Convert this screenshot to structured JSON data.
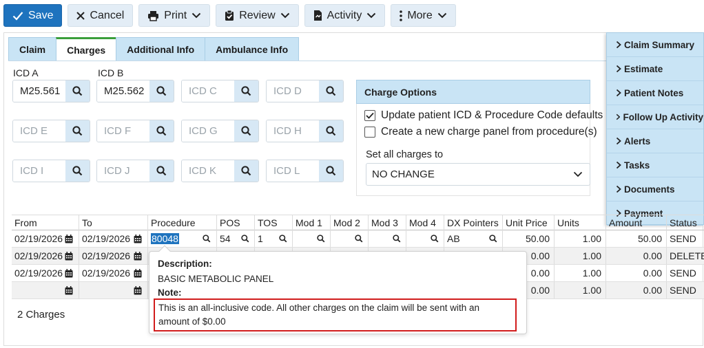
{
  "toolbar": {
    "save": "Save",
    "cancel": "Cancel",
    "print": "Print",
    "review": "Review",
    "activity": "Activity",
    "more": "More"
  },
  "tabs": [
    "Claim",
    "Charges",
    "Additional Info",
    "Ambulance Info"
  ],
  "icd": {
    "label_a": "ICD A",
    "label_b": "ICD B",
    "fields": [
      {
        "placeholder": "ICD A",
        "value": "M25.561"
      },
      {
        "placeholder": "ICD B",
        "value": "M25.562"
      },
      {
        "placeholder": "ICD C",
        "value": ""
      },
      {
        "placeholder": "ICD D",
        "value": ""
      },
      {
        "placeholder": "ICD E",
        "value": ""
      },
      {
        "placeholder": "ICD F",
        "value": ""
      },
      {
        "placeholder": "ICD G",
        "value": ""
      },
      {
        "placeholder": "ICD H",
        "value": ""
      },
      {
        "placeholder": "ICD I",
        "value": ""
      },
      {
        "placeholder": "ICD J",
        "value": ""
      },
      {
        "placeholder": "ICD K",
        "value": ""
      },
      {
        "placeholder": "ICD L",
        "value": ""
      }
    ]
  },
  "charge_options": {
    "title": "Charge Options",
    "update_defaults": "Update patient ICD & Procedure Code defaults",
    "update_checked": true,
    "new_panel": "Create a new charge panel from procedure(s)",
    "new_panel_checked": false,
    "set_all_label": "Set all charges to",
    "set_all_value": "NO CHANGE"
  },
  "right_panel": [
    "Claim Summary",
    "Estimate",
    "Patient Notes",
    "Follow Up Activity",
    "Alerts",
    "Tasks",
    "Documents",
    "Payment"
  ],
  "table": {
    "headers": [
      "From",
      "To",
      "Procedure",
      "POS",
      "TOS",
      "Mod 1",
      "Mod 2",
      "Mod 3",
      "Mod 4",
      "DX Pointers",
      "Unit Price",
      "Units",
      "Amount",
      "Status"
    ],
    "rows": [
      {
        "from": "02/19/2026",
        "to": "02/19/2026",
        "procedure": "80048",
        "pos": "54",
        "tos": "1",
        "dx": "AB",
        "unit_price": "50.00",
        "units": "1.00",
        "amount": "50.00",
        "status": "SEND"
      },
      {
        "from": "02/19/2026",
        "to": "02/19/2026",
        "procedure": "",
        "pos": "",
        "tos": "",
        "dx": "",
        "unit_price": "0.00",
        "units": "1.00",
        "amount": "0.00",
        "status": "DELETE"
      },
      {
        "from": "02/19/2026",
        "to": "02/19/2026",
        "procedure": "",
        "pos": "",
        "tos": "",
        "dx": "",
        "unit_price": "0.00",
        "units": "1.00",
        "amount": "0.00",
        "status": "SEND"
      },
      {
        "from": "",
        "to": "",
        "procedure": "",
        "pos": "",
        "tos": "",
        "dx": "",
        "unit_price": "0.00",
        "units": "1.00",
        "amount": "0.00",
        "status": "SEND"
      }
    ]
  },
  "charge_count": "2 Charges",
  "popover": {
    "desc_label": "Description:",
    "desc_value": "BASIC METABOLIC PANEL",
    "note_label": "Note:",
    "note_value": "This is an all-inclusive code. All other charges on the claim will be sent with an amount of $0.00"
  },
  "colors": {
    "primary": "#1e73be",
    "tab_bg": "#c9e4f5",
    "active_tab_border": "#3a9e3a",
    "note_border": "#d11b1b"
  }
}
